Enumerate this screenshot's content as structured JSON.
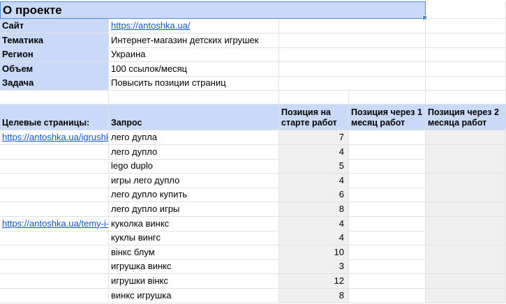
{
  "project": {
    "title": "О проекте",
    "rows": [
      {
        "label": "Сайт",
        "value": "https://antoshka.ua/",
        "is_link": true
      },
      {
        "label": "Тематика",
        "value": "Интернет-магазин детских игрушек"
      },
      {
        "label": "Регион",
        "value": "Украина"
      },
      {
        "label": "Объем",
        "value": "100 ссылок/месяц"
      },
      {
        "label": "Задача",
        "value": "Повысить позиции страниц"
      }
    ]
  },
  "table": {
    "headers": {
      "pages": "Целевые страницы:",
      "query": "Запрос",
      "start": "Позиция на старте работ",
      "month1": "Позиция через 1 месяц работ",
      "month2": "Позиция через 2 месяца работ"
    },
    "rows": [
      {
        "page": "https://antoshka.ua/igrushki",
        "query": "лего дупла",
        "start": "7"
      },
      {
        "page": "",
        "query": "лего дупло",
        "start": "4"
      },
      {
        "page": "",
        "query": "lego duplo",
        "start": "5"
      },
      {
        "page": "",
        "query": "игры лего дупло",
        "start": "4"
      },
      {
        "page": "",
        "query": "лего дупло купить",
        "start": "6"
      },
      {
        "page": "",
        "query": "лего дупло игры",
        "start": "8"
      },
      {
        "page": "https://antoshka.ua/temy-i-p",
        "query": "куколка винкс",
        "start": "4"
      },
      {
        "page": "",
        "query": "куклы вингс",
        "start": "4"
      },
      {
        "page": "",
        "query": "вінкс блум",
        "start": "10"
      },
      {
        "page": "",
        "query": "игрушка винкс",
        "start": "3"
      },
      {
        "page": "",
        "query": "игрушки вінкс",
        "start": "12"
      },
      {
        "page": "",
        "query": "винкс игрушка",
        "start": "8"
      }
    ]
  }
}
